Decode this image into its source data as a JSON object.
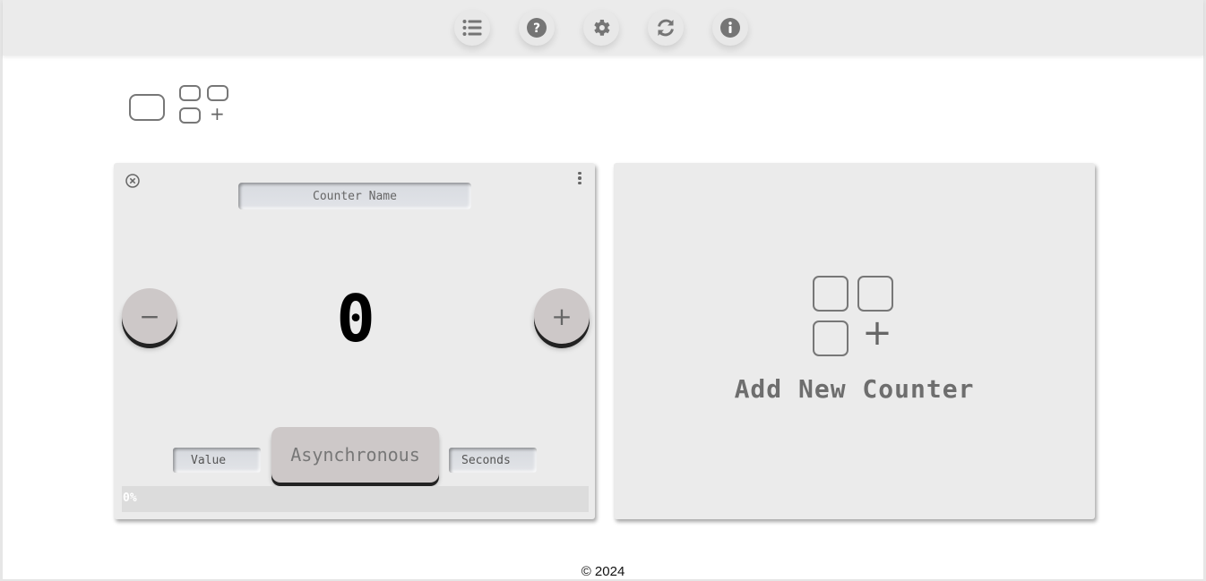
{
  "toolbar": {
    "buttons": [
      {
        "icon": "list-icon",
        "title": "List"
      },
      {
        "icon": "help-icon",
        "title": "Help"
      },
      {
        "icon": "gear-icon",
        "title": "Settings"
      },
      {
        "icon": "refresh-icon",
        "title": "Refresh"
      },
      {
        "icon": "info-icon",
        "title": "Info"
      }
    ],
    "icon_color": "#757575"
  },
  "layout_toggle": {
    "single_icon": "single-layout-icon",
    "multi_icon": "grid-add-layout-icon",
    "multi_plus": "+"
  },
  "counter_card": {
    "name_placeholder": "Counter Name",
    "name_value": "",
    "decrement_label": "−",
    "increment_label": "+",
    "count": "0",
    "value_placeholder": "Value",
    "mode_label": "Asynchronous",
    "seconds_placeholder": "Seconds",
    "progress": 0,
    "progress_label": "0%"
  },
  "add_card": {
    "plus": "+",
    "label": "Add New Counter"
  },
  "footer": {
    "text": "© 2024"
  }
}
